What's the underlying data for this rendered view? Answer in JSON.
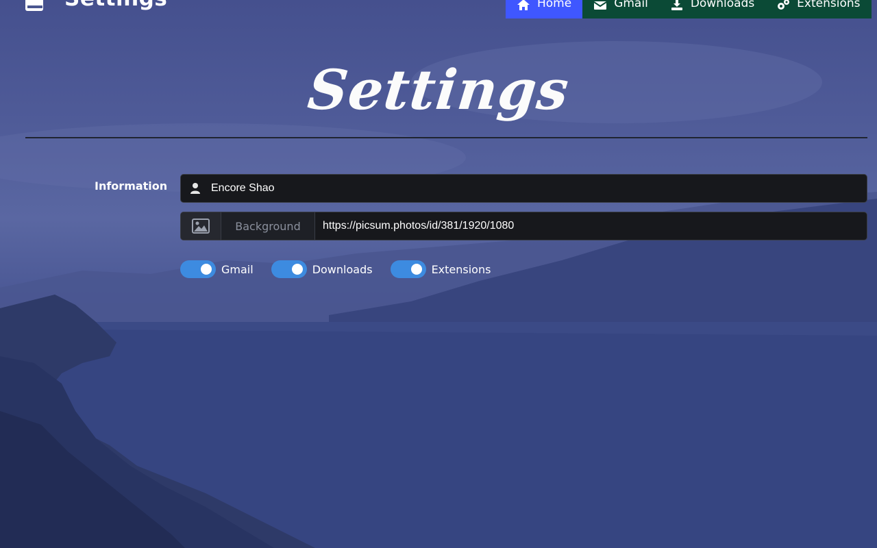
{
  "app": {
    "brand_title": "Settings"
  },
  "nav": {
    "items": [
      {
        "label": "Home",
        "icon": "home-icon",
        "active": true
      },
      {
        "label": "Gmail",
        "icon": "gmail-icon",
        "active": false
      },
      {
        "label": "Downloads",
        "icon": "download-icon",
        "active": false
      },
      {
        "label": "Extensions",
        "icon": "gears-icon",
        "active": false
      }
    ],
    "active_color": "#3f57ff",
    "inactive_color": "#0b4a36"
  },
  "page": {
    "title": "Settings"
  },
  "form": {
    "section_label": "Information",
    "name_field": {
      "value": "Encore Shao",
      "icon": "user-icon"
    },
    "background_field": {
      "addon_icon": "image-icon",
      "addon_label": "Background",
      "value": "https://picsum.photos/id/381/1920/1080"
    },
    "toggles": [
      {
        "label": "Gmail",
        "checked": true
      },
      {
        "label": "Downloads",
        "checked": true
      },
      {
        "label": "Extensions",
        "checked": true
      }
    ],
    "toggle_color": "#3d8be0"
  }
}
